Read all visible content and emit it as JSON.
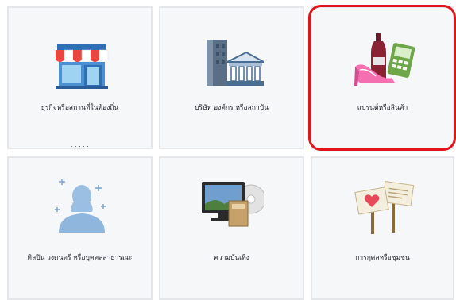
{
  "categories": [
    {
      "id": "local-business",
      "label": "ธุรกิจหรือสถานที่ในท้องถิ่น",
      "sublabel": ". . . . .",
      "icon": "storefront-icon"
    },
    {
      "id": "company",
      "label": "บริษัท องค์กร หรือสถาบัน",
      "icon": "office-building-icon"
    },
    {
      "id": "brand",
      "label": "แบรนด์หรือสินค้า",
      "icon": "brand-products-icon",
      "highlighted": true
    },
    {
      "id": "artist",
      "label": "ศิลปิน วงดนตรี หรือบุคคลสาธารณะ",
      "icon": "person-silhouette-icon"
    },
    {
      "id": "entertainment",
      "label": "ความบันเทิง",
      "icon": "entertainment-icon"
    },
    {
      "id": "cause",
      "label": "การกุศลหรือชุมชน",
      "icon": "signboard-icon"
    }
  ],
  "colors": {
    "highlight": "#e0141b",
    "tile_bg": "#f6f7f9",
    "tile_border": "#e5e6e9"
  }
}
